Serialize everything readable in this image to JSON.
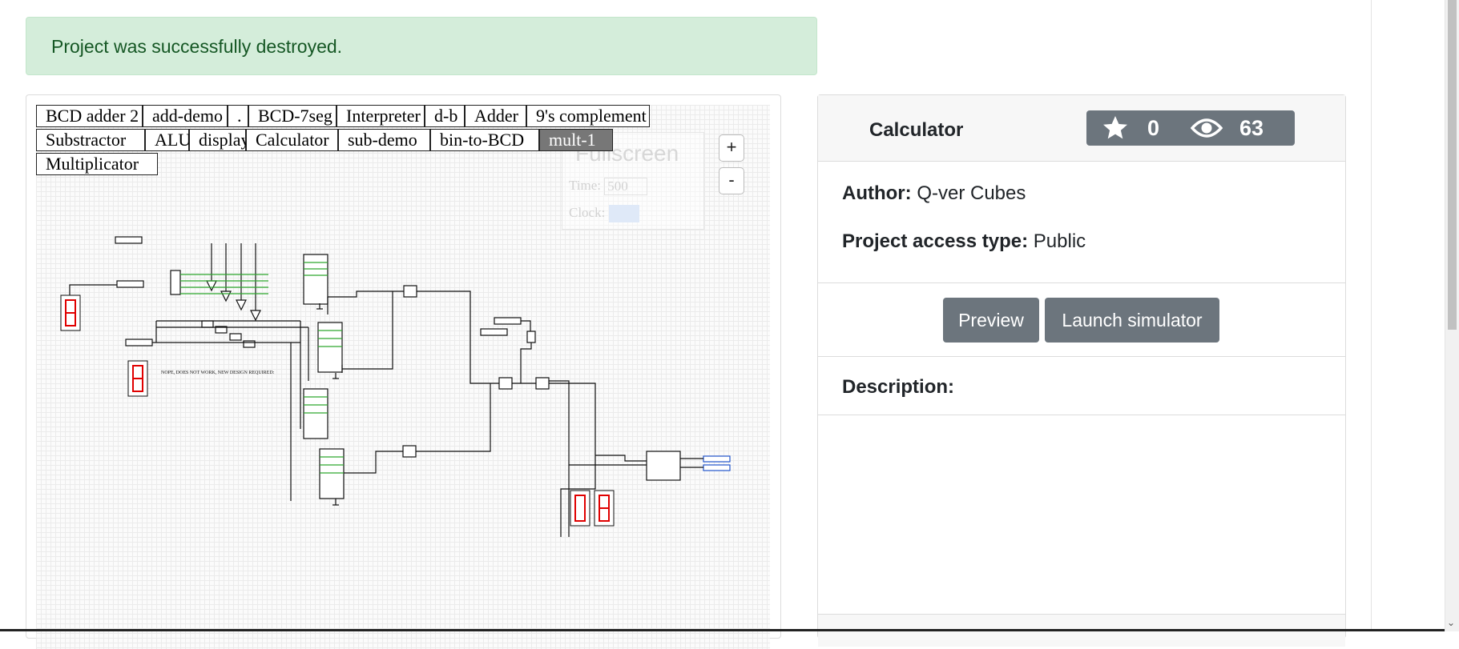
{
  "alert": {
    "message": "Project was successfully destroyed."
  },
  "simulator": {
    "tabs_row1": [
      "BCD adder 2",
      "add-demo",
      ".",
      "BCD-7seg",
      "Interpreter",
      "d-b",
      "Adder",
      "9's complement"
    ],
    "tabs_row2": [
      "Substractor",
      "ALU",
      "display",
      "Calculator",
      "sub-demo",
      "bin-to-BCD",
      "mult-1"
    ],
    "tabs_row3": [
      "Multiplicator"
    ],
    "active_tab": "mult-1",
    "zoom_in_label": "+",
    "zoom_out_label": "-",
    "overlay": {
      "fullscreen_label": "Fullscreen",
      "time_label": "Time:",
      "time_value": "500",
      "clock_label": "Clock:"
    },
    "circuit_note": "NOPE, DOES NOT WORK, NEW DESIGN REQUIRED:"
  },
  "project": {
    "name": "Calculator",
    "stars": "0",
    "views": "63",
    "author_label": "Author:",
    "author": "Q-ver Cubes",
    "access_label": "Project access type:",
    "access": "Public",
    "preview_button": "Preview",
    "launch_button": "Launch simulator",
    "description_label": "Description:"
  },
  "colors": {
    "alert_bg": "#d4edda",
    "alert_text": "#155724",
    "button_bg": "#6c757d",
    "segment_red": "#e00000",
    "wire_green": "#2ea62e"
  }
}
